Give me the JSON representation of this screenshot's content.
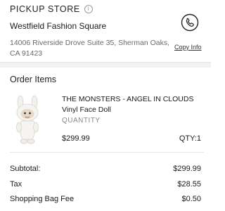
{
  "pickup": {
    "title": "PICKUP STORE",
    "info_icon": "info-icon",
    "store_name": "Westfield Fashion Square",
    "address": "14006 Riverside Drove Suite 35, Sherman Oaks, CA 91423",
    "phone_icon": "phone-icon",
    "copy_info": "Copy Info"
  },
  "order": {
    "title": "Order Items",
    "item": {
      "name": "THE MONSTERS - ANGEL IN CLOUDS Vinyl Face Doll",
      "quantity_label": "QUANTITY",
      "price": "$299.99",
      "qty": "QTY:1"
    }
  },
  "summary": {
    "subtotal_label": "Subtotal:",
    "subtotal_value": "$299.99",
    "tax_label": "Tax",
    "tax_value": "$28.55",
    "bag_fee_label": "Shopping Bag Fee",
    "bag_fee_value": "$0.50"
  }
}
